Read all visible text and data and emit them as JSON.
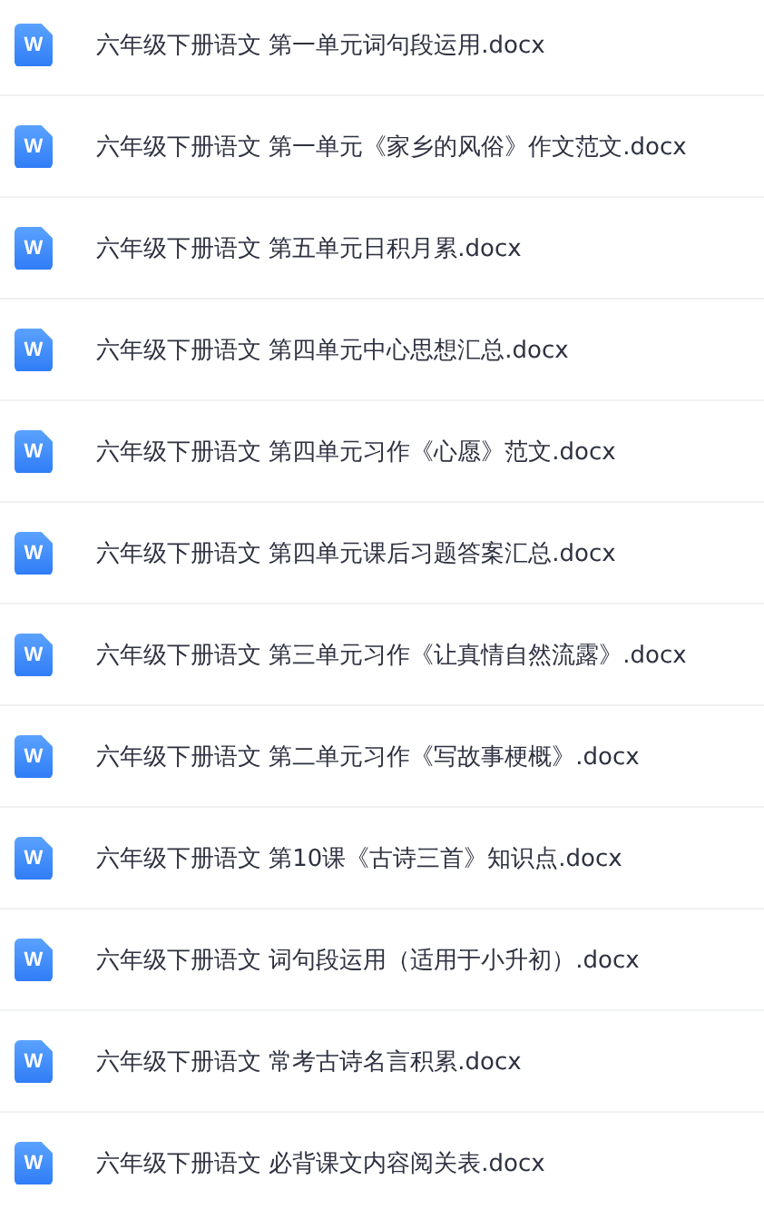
{
  "files": [
    {
      "icon_letter": "W",
      "name": "六年级下册语文 第一单元词句段运用.docx"
    },
    {
      "icon_letter": "W",
      "name": "六年级下册语文 第一单元《家乡的风俗》作文范文.docx"
    },
    {
      "icon_letter": "W",
      "name": "六年级下册语文 第五单元日积月累.docx"
    },
    {
      "icon_letter": "W",
      "name": "六年级下册语文 第四单元中心思想汇总.docx"
    },
    {
      "icon_letter": "W",
      "name": "六年级下册语文 第四单元习作《心愿》范文.docx"
    },
    {
      "icon_letter": "W",
      "name": "六年级下册语文 第四单元课后习题答案汇总.docx"
    },
    {
      "icon_letter": "W",
      "name": "六年级下册语文 第三单元习作《让真情自然流露》.docx"
    },
    {
      "icon_letter": "W",
      "name": "六年级下册语文 第二单元习作《写故事梗概》.docx"
    },
    {
      "icon_letter": "W",
      "name": "六年级下册语文 第10课《古诗三首》知识点.docx"
    },
    {
      "icon_letter": "W",
      "name": "六年级下册语文 词句段运用（适用于小升初）.docx"
    },
    {
      "icon_letter": "W",
      "name": "六年级下册语文 常考古诗名言积累.docx"
    },
    {
      "icon_letter": "W",
      "name": "六年级下册语文 必背课文内容阅关表.docx"
    }
  ]
}
